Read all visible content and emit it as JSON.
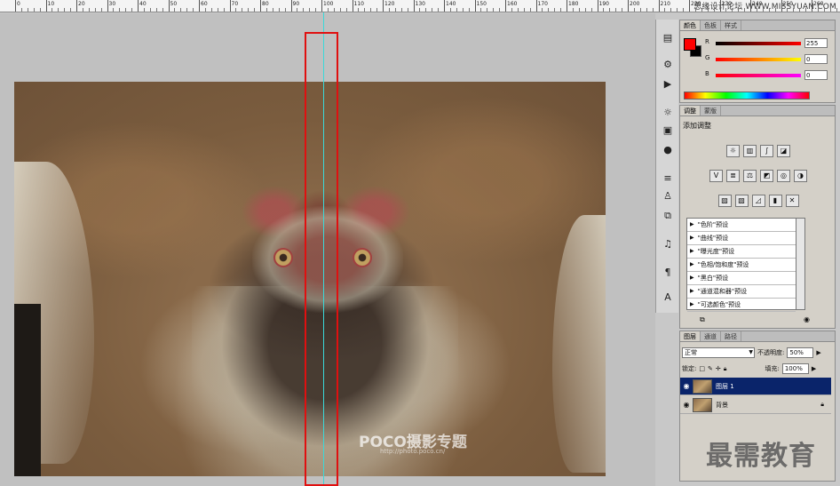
{
  "ruler": {
    "labels": [
      "0",
      "10",
      "20",
      "30",
      "40",
      "50",
      "60",
      "70",
      "80",
      "90",
      "100",
      "110",
      "120",
      "130",
      "140",
      "150",
      "160",
      "170",
      "180",
      "190",
      "200",
      "210",
      "220",
      "230",
      "240",
      "250",
      "260",
      "270"
    ],
    "watermark": "思缘设计论坛 WWW.MISSYUAN.COM"
  },
  "canvas": {
    "poco_logo": "POCO摄影专题",
    "poco_url": "http://photo.poco.cn/"
  },
  "iconbar": {
    "icons": [
      "palette-icon",
      "brush-settings-icon",
      "play-icon",
      "sun-icon",
      "adjust-icon",
      "info-icon",
      "brush-icon",
      "stamp-icon",
      "layer-comp-icon",
      "clone-source-icon",
      "paragraph-icon",
      "character-icon"
    ]
  },
  "color_panel": {
    "tabs": [
      "颜色",
      "色板",
      "样式"
    ],
    "r_label": "R",
    "g_label": "G",
    "b_label": "B",
    "r_value": "255",
    "g_value": "0",
    "b_value": "0",
    "fg_color": "#ff0000",
    "bg_color": "#000000"
  },
  "adjust_panel": {
    "tabs": [
      "调整",
      "蒙版"
    ],
    "title": "添加调整",
    "presets": [
      "\"色阶\"预设",
      "\"曲线\"预设",
      "\"曝光度\"预设",
      "\"色相/饱和度\"预设",
      "\"黑白\"预设",
      "\"通道混和器\"预设",
      "\"可选颜色\"预设"
    ]
  },
  "layers_panel": {
    "tabs": [
      "图层",
      "通道",
      "路径"
    ],
    "blend_mode": "正常",
    "opacity_label": "不透明度:",
    "opacity_value": "50%",
    "lock_label": "锁定:",
    "fill_label": "填充:",
    "fill_value": "100%",
    "layers": [
      {
        "name": "图层 1",
        "selected": true
      },
      {
        "name": "背景",
        "selected": false
      }
    ]
  },
  "bottom_watermark": "最需教育"
}
